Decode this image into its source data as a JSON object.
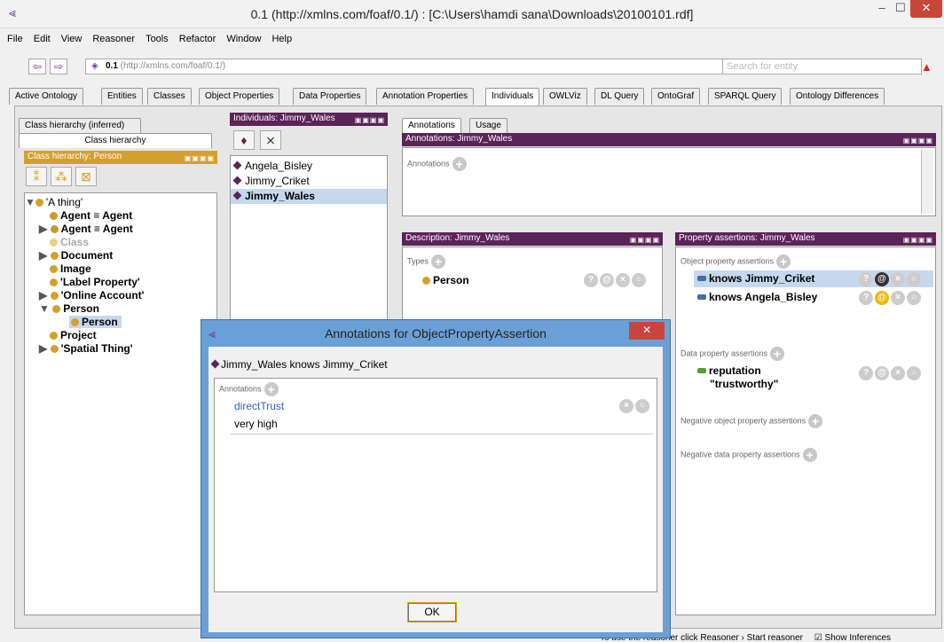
{
  "window": {
    "title": "0.1 (http://xmlns.com/foaf/0.1/)  : [C:\\Users\\hamdi sana\\Downloads\\20100101.rdf]",
    "min": "–",
    "max": "☐",
    "close": "✕"
  },
  "menu": [
    "File",
    "Edit",
    "View",
    "Reasoner",
    "Tools",
    "Refactor",
    "Window",
    "Help"
  ],
  "nav": {
    "back": "⇦",
    "forward": "⇨",
    "address_bold": "0.1",
    "address_rest": " (http://xmlns.com/foaf/0.1/)",
    "search_placeholder": "Search for entity",
    "warning": "▲"
  },
  "tabs": [
    "Active Ontology",
    "Entities",
    "Classes",
    "Object Properties",
    "Data Properties",
    "Annotation Properties",
    "Individuals",
    "OWLViz",
    "DL Query",
    "OntoGraf",
    "SPARQL Query",
    "Ontology Differences"
  ],
  "class_panel": {
    "tab_inferred": "Class hierarchy (inferred)",
    "tab_class": "Class hierarchy",
    "header": "Class hierarchy: Person",
    "tree": [
      "'A thing'",
      "Agent ≡ Agent",
      "Agent ≡ Agent",
      "Class",
      "Document",
      "Image",
      "'Label Property'",
      "'Online Account'",
      "Person",
      "Person",
      "Project",
      "'Spatial Thing'"
    ]
  },
  "individuals_panel": {
    "header": "Individuals: Jimmy_Wales",
    "items": [
      "Angela_Bisley",
      "Jimmy_Criket",
      "Jimmy_Wales"
    ]
  },
  "annotations_panel": {
    "tab_annotations": "Annotations",
    "tab_usage": "Usage",
    "header": "Annotations: Jimmy_Wales",
    "section": "Annotations"
  },
  "description_panel": {
    "header": "Description: Jimmy_Wales",
    "types_label": "Types",
    "type": "Person"
  },
  "property_panel": {
    "header": "Property assertions: Jimmy_Wales",
    "obj_label": "Object property assertions",
    "obj_items": [
      "knows  Jimmy_Criket",
      "knows  Angela_Bisley"
    ],
    "data_label": "Data property assertions",
    "data_prop": "reputation",
    "data_value": "\"trustworthy\"",
    "neg_obj": "Negative object property assertions",
    "neg_data": "Negative data property assertions"
  },
  "dialog": {
    "title": "Annotations for ObjectPropertyAssertion",
    "close": "✕",
    "statement": "Jimmy_Wales knows Jimmy_Criket",
    "section": "Annotations",
    "property": "directTrust",
    "value": "very high",
    "ok": "OK"
  },
  "status": {
    "text": "To use the reasoner click Reasoner › Start reasoner",
    "show_inferences": "Show Inferences"
  }
}
